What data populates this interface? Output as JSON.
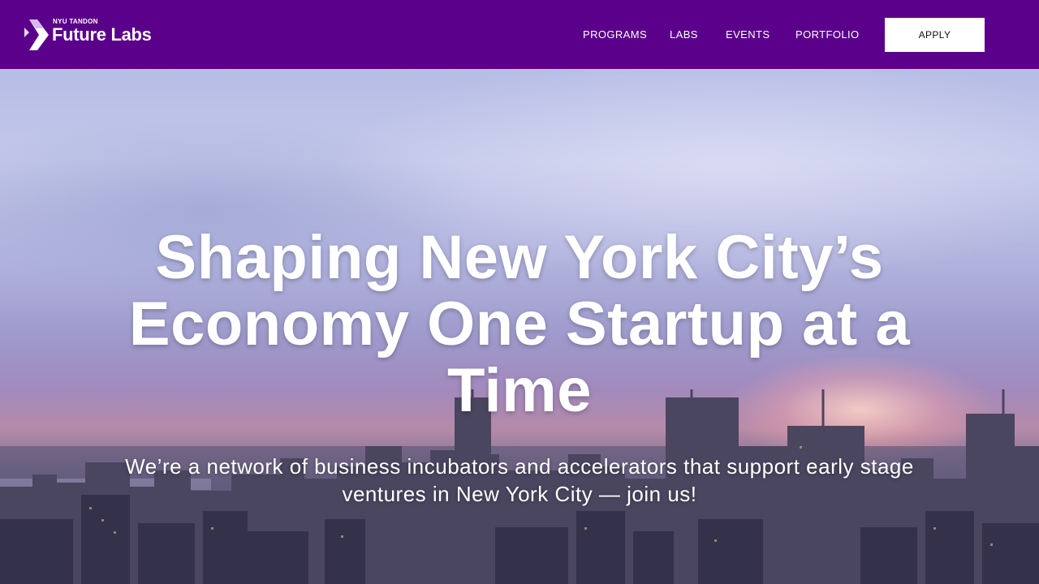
{
  "header": {
    "logo_small": "NYU TANDON",
    "logo_big": "Future Labs",
    "background_color": "#5a008a"
  },
  "nav": {
    "links": [
      {
        "label": "PROGRAMS"
      },
      {
        "label": "LABS"
      },
      {
        "label": "EVENTS"
      },
      {
        "label": "PORTFOLIO"
      }
    ],
    "apply_label": "APPLY"
  },
  "hero": {
    "title": "Shaping New York City’s Economy One Startup at a Time",
    "subtitle": "We’re a network of business incubators and accelerators that support early stage ventures in New York City — join us!",
    "background_image": "new-york-city-skyline-at-sunset"
  },
  "colors": {
    "brand_purple": "#5a008a",
    "text_on_dark": "#ffffff"
  }
}
